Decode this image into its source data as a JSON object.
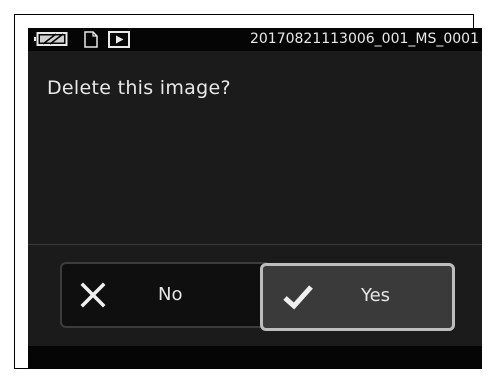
{
  "status_bar": {
    "file_name": "20170821113006_001_MS_0001",
    "icons": [
      "card-slot-icon",
      "file-icon",
      "play-icon"
    ]
  },
  "dialog": {
    "message": "Delete this image?",
    "no_button": {
      "label": "No",
      "icon": "close-icon"
    },
    "yes_button": {
      "label": "Yes",
      "icon": "checkmark-icon",
      "selected": true
    }
  },
  "colors": {
    "screen_background": "#1b1b1b",
    "text": "#e8e8e8",
    "selected_border": "#bdbdbd"
  }
}
